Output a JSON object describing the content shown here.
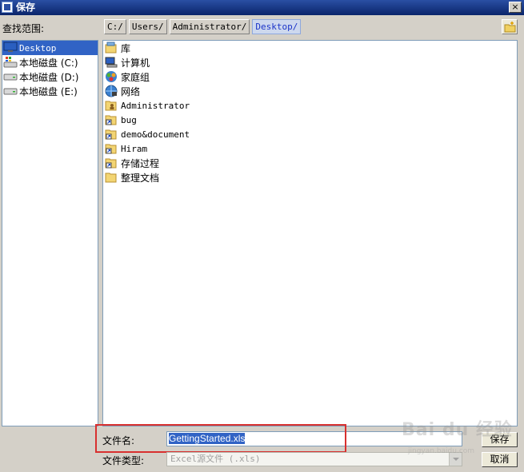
{
  "window": {
    "title": "保存",
    "close_glyph": "×"
  },
  "lookin": {
    "label": "查找范围:",
    "path": [
      "C:/",
      "Users/",
      "Administrator/",
      "Desktop/"
    ],
    "active_index": 3
  },
  "places": [
    {
      "label": "Desktop",
      "icon": "desktop-icon",
      "selected": true
    },
    {
      "label": "本地磁盘  (C:)",
      "icon": "system-drive-icon"
    },
    {
      "label": "本地磁盘  (D:)",
      "icon": "drive-icon"
    },
    {
      "label": "本地磁盘  (E:)",
      "icon": "drive-icon"
    }
  ],
  "files": [
    {
      "label": "库",
      "icon": "library-icon"
    },
    {
      "label": "计算机",
      "icon": "computer-icon"
    },
    {
      "label": "家庭组",
      "icon": "homegroup-icon"
    },
    {
      "label": "网络",
      "icon": "network-icon"
    },
    {
      "label": "Administrator",
      "icon": "user-folder-icon"
    },
    {
      "label": "bug",
      "icon": "shortcut-icon"
    },
    {
      "label": "demo&document",
      "icon": "shortcut-icon"
    },
    {
      "label": "Hiram",
      "icon": "shortcut-icon"
    },
    {
      "label": "存储过程",
      "icon": "shortcut-icon"
    },
    {
      "label": "整理文档",
      "icon": "folder-icon"
    }
  ],
  "filename": {
    "label": "文件名:",
    "value": "GettingStarted.xls"
  },
  "filetype": {
    "label": "文件类型:",
    "value": "Excel源文件 (.xls)"
  },
  "buttons": {
    "save": "保存",
    "cancel": "取消"
  },
  "watermark": {
    "brand": "Bai du 经验",
    "url": "jingyan.baidu.com"
  },
  "colors": {
    "titlebar": "#0a246a",
    "selection": "#3163c5",
    "highlight_box": "#d8302f",
    "active_crumb": "#1a33c8"
  }
}
